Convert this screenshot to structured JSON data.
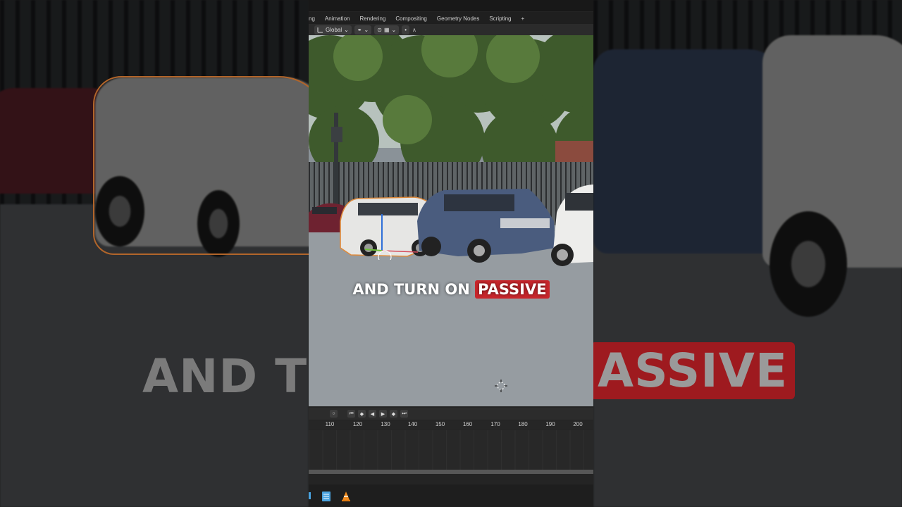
{
  "workspace_tabs": [
    "ng",
    "Animation",
    "Rendering",
    "Compositing",
    "Geometry Nodes",
    "Scripting",
    "+"
  ],
  "header_toolbar": {
    "transform_orientation": "Global"
  },
  "subtitle": {
    "before": "AND TURN ON",
    "highlight": "PASSIVE"
  },
  "background_text": {
    "left": "AND T",
    "right": "ASSIVE"
  },
  "timeline": {
    "frame_ticks": [
      "110",
      "120",
      "130",
      "140",
      "150",
      "160",
      "170",
      "180",
      "190",
      "200"
    ]
  },
  "taskbar_icons": [
    "notepad-icon",
    "vlc-icon"
  ],
  "colors": {
    "highlight_red": "#c8262c",
    "selection_outline": "#e08a3a"
  }
}
